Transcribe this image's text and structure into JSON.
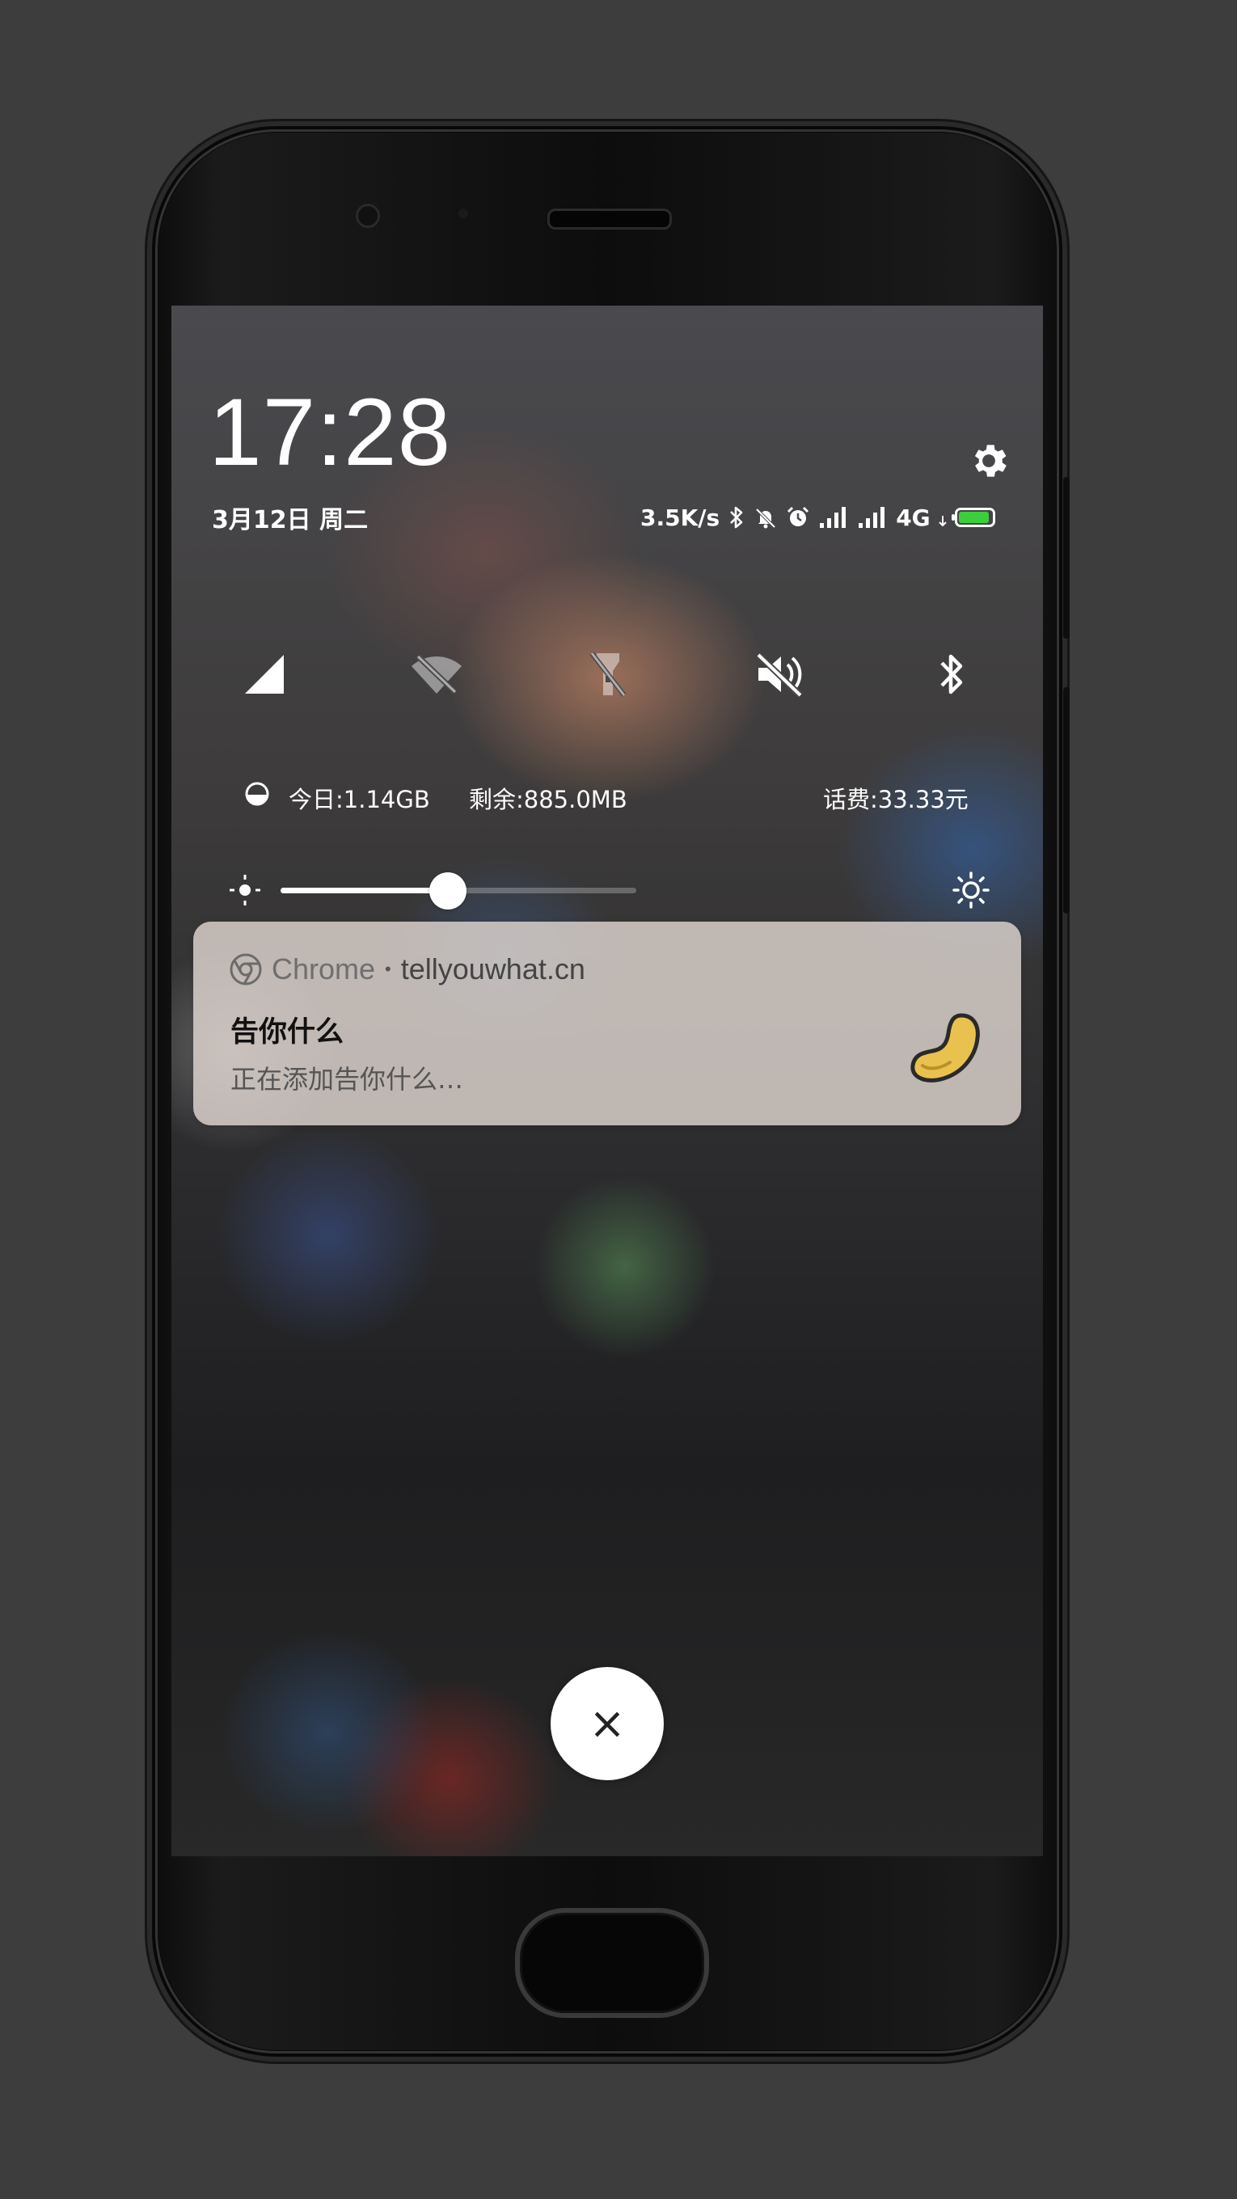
{
  "lockscreen": {
    "time": "17:28",
    "date": "3月12日 周二"
  },
  "status_bar": {
    "speed": "3.5K/s",
    "network": "4G",
    "battery_level": 0.95,
    "battery_color": "#3ccf3c",
    "icons": [
      "bluetooth-icon",
      "mute-bell-icon",
      "alarm-icon",
      "signal-icon",
      "signal-icon",
      "battery-icon"
    ]
  },
  "quick_toggles": [
    {
      "name": "mobile-data-icon",
      "active": true
    },
    {
      "name": "wifi-off-icon",
      "active": false
    },
    {
      "name": "flashlight-icon",
      "active": false
    },
    {
      "name": "mute-icon",
      "active": true
    },
    {
      "name": "bluetooth-icon",
      "active": true
    }
  ],
  "data_usage": {
    "today": "今日:1.14GB",
    "remaining": "剩余:885.0MB",
    "balance": "话费:33.33元"
  },
  "brightness": {
    "level": 0.47
  },
  "notification": {
    "app_name": "Chrome",
    "separator": "•",
    "site": "tellyouwhat.cn",
    "title": "告你什么",
    "text": "正在添加告你什么…"
  },
  "close_button": {
    "label": "×"
  }
}
